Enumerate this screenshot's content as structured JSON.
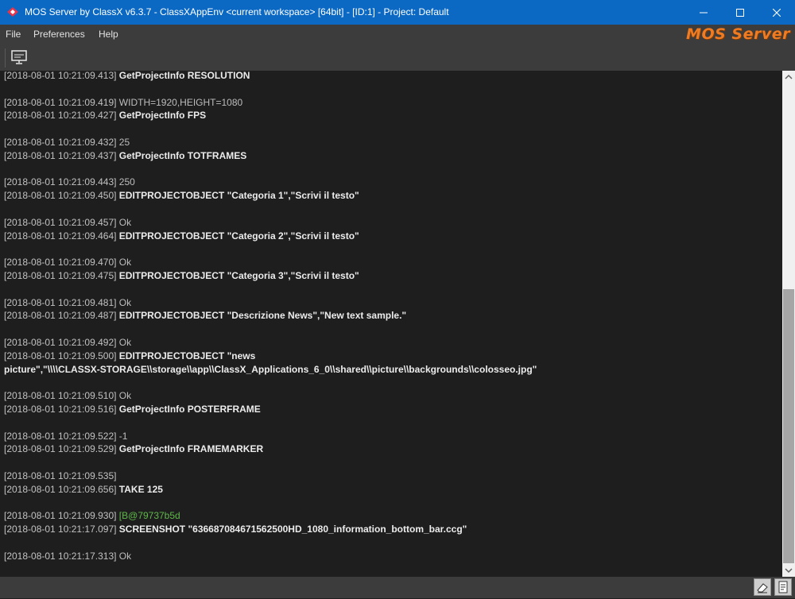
{
  "window": {
    "title": "MOS Server by ClassX v6.3.7 - ClassXAppEnv <current workspace>  [64bit] - [ID:1] - Project: Default",
    "controls": [
      "minimize-icon",
      "maximize-icon",
      "close-icon"
    ]
  },
  "menu": {
    "file": "File",
    "preferences": "Preferences",
    "help": "Help"
  },
  "logo": "MOS Server",
  "toolbar": {
    "buttons": [
      {
        "icon": "monitor-icon"
      }
    ]
  },
  "log": {
    "lines": [
      {
        "ts": "[2018-08-01 10:21:09.413]",
        "text": "GetProjectInfo RESOLUTION",
        "kind": "cmd"
      },
      {
        "blank": true
      },
      {
        "ts": "[2018-08-01 10:21:09.419]",
        "text": "WIDTH=1920,HEIGHT=1080",
        "kind": "rsp"
      },
      {
        "ts": "[2018-08-01 10:21:09.427]",
        "text": "GetProjectInfo FPS",
        "kind": "cmd"
      },
      {
        "blank": true
      },
      {
        "ts": "[2018-08-01 10:21:09.432]",
        "text": "25",
        "kind": "rsp"
      },
      {
        "ts": "[2018-08-01 10:21:09.437]",
        "text": "GetProjectInfo TOTFRAMES",
        "kind": "cmd"
      },
      {
        "blank": true
      },
      {
        "ts": "[2018-08-01 10:21:09.443]",
        "text": "250",
        "kind": "rsp"
      },
      {
        "ts": "[2018-08-01 10:21:09.450]",
        "text": "EDITPROJECTOBJECT \"Categoria 1\",\"Scrivi il testo\"",
        "kind": "cmd"
      },
      {
        "blank": true
      },
      {
        "ts": "[2018-08-01 10:21:09.457]",
        "text": "Ok",
        "kind": "rsp"
      },
      {
        "ts": "[2018-08-01 10:21:09.464]",
        "text": "EDITPROJECTOBJECT \"Categoria 2\",\"Scrivi il testo\"",
        "kind": "cmd"
      },
      {
        "blank": true
      },
      {
        "ts": "[2018-08-01 10:21:09.470]",
        "text": "Ok",
        "kind": "rsp"
      },
      {
        "ts": "[2018-08-01 10:21:09.475]",
        "text": "EDITPROJECTOBJECT \"Categoria 3\",\"Scrivi il testo\"",
        "kind": "cmd"
      },
      {
        "blank": true
      },
      {
        "ts": "[2018-08-01 10:21:09.481]",
        "text": "Ok",
        "kind": "rsp"
      },
      {
        "ts": "[2018-08-01 10:21:09.487]",
        "text": "EDITPROJECTOBJECT \"Descrizione News\",\"New text sample.\"",
        "kind": "cmd"
      },
      {
        "blank": true
      },
      {
        "ts": "[2018-08-01 10:21:09.492]",
        "text": "Ok",
        "kind": "rsp"
      },
      {
        "ts": "[2018-08-01 10:21:09.500]",
        "text": "EDITPROJECTOBJECT \"news",
        "kind": "cmd"
      },
      {
        "cont": "picture\",\"\\\\\\\\CLASSX-STORAGE\\\\storage\\\\app\\\\ClassX_Applications_6_0\\\\shared\\\\picture\\\\backgrounds\\\\colosseo.jpg\""
      },
      {
        "blank": true
      },
      {
        "ts": "[2018-08-01 10:21:09.510]",
        "text": "Ok",
        "kind": "rsp"
      },
      {
        "ts": "[2018-08-01 10:21:09.516]",
        "text": "GetProjectInfo POSTERFRAME",
        "kind": "cmd"
      },
      {
        "blank": true
      },
      {
        "ts": "[2018-08-01 10:21:09.522]",
        "text": "-1",
        "kind": "rsp"
      },
      {
        "ts": "[2018-08-01 10:21:09.529]",
        "text": "GetProjectInfo FRAMEMARKER",
        "kind": "cmd"
      },
      {
        "blank": true
      },
      {
        "ts": "[2018-08-01 10:21:09.535]",
        "text": "",
        "kind": "rsp"
      },
      {
        "ts": "[2018-08-01 10:21:09.656]",
        "text": "TAKE 125",
        "kind": "cmd"
      },
      {
        "blank": true
      },
      {
        "ts": "[2018-08-01 10:21:09.930]",
        "text": "[B@79737b5d",
        "kind": "rsp",
        "color": "#5fb84a"
      },
      {
        "ts": "[2018-08-01 10:21:17.097]",
        "text": "SCREENSHOT \"636687084671562500HD_1080_information_bottom_bar.ccg\"",
        "kind": "cmd"
      },
      {
        "blank": true
      },
      {
        "ts": "[2018-08-01 10:21:17.313]",
        "text": "Ok",
        "kind": "rsp"
      }
    ]
  },
  "colors": {
    "titlebar": "#0b69c4",
    "chrome": "#3c3c3c",
    "log_background": "#1e1e1e",
    "accent_orange": "#ef7b22",
    "green_text": "#5fb84a"
  },
  "statusbar": {
    "buttons": [
      {
        "icon": "eraser-icon"
      },
      {
        "icon": "log-icon"
      }
    ]
  }
}
